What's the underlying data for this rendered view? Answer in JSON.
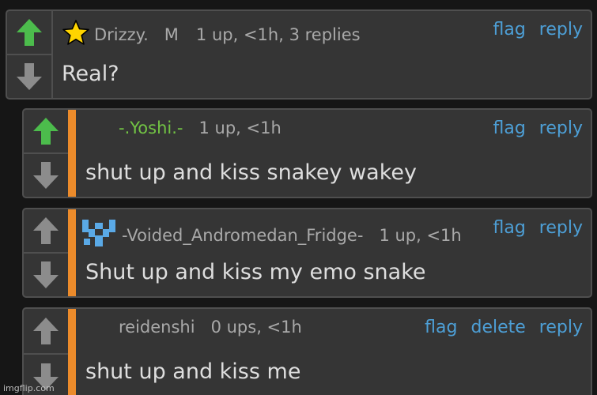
{
  "colors": {
    "page_bg": "#161616",
    "card_bg": "#353535",
    "card_border": "#4f4f4f",
    "upvoted": "#4cbc4c",
    "neutral_arrow": "#8c8c8c",
    "reply_accent": "#ec8b2b",
    "link": "#4d9fd6",
    "username": "#a9a9a9",
    "username_green": "#72c444",
    "body_text": "#dedede"
  },
  "comments": [
    {
      "username": "Drizzy.",
      "mod_badge": "M",
      "stats": "1 up, <1h, 3 replies",
      "text": "Real?",
      "badge_icon": "star-icon",
      "upvoted": true,
      "actions": [
        "flag",
        "reply"
      ]
    },
    {
      "username": "-.Yoshi.-",
      "stats": "1 up, <1h",
      "text": "shut up and kiss snakey wakey",
      "upvoted": true,
      "actions": [
        "flag",
        "reply"
      ]
    },
    {
      "username": "-Voided_Andromedan_Fridge-",
      "stats": "1 up, <1h",
      "text": "Shut up and kiss my emo snake",
      "badge_icon": "pixel-emblem-icon",
      "upvoted": false,
      "actions": [
        "flag",
        "reply"
      ]
    },
    {
      "username": "reidenshi",
      "stats": "0 ups, <1h",
      "text": "shut up and kiss me",
      "upvoted": false,
      "actions": [
        "flag",
        "delete",
        "reply"
      ]
    }
  ],
  "watermark": "imgflip.com"
}
